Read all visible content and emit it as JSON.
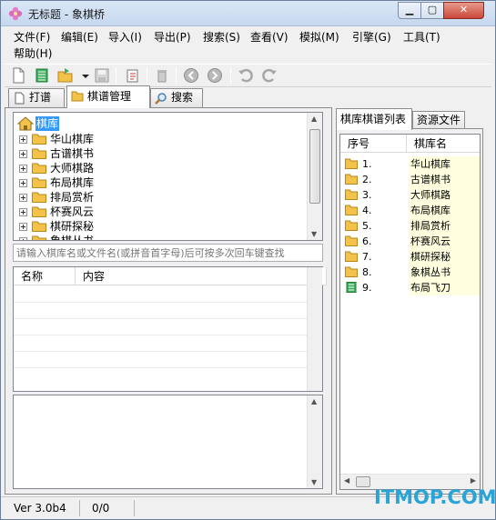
{
  "window": {
    "title": "无标题 - 象棋桥"
  },
  "menu": [
    "文件(F)",
    "编辑(E)",
    "导入(I)",
    "导出(P)",
    "搜索(S)",
    "查看(V)",
    "模拟(M)",
    "引擎(G)",
    "工具(T)",
    "帮助(H)"
  ],
  "left_tabs": [
    "打谱",
    "棋谱管理",
    "搜索"
  ],
  "tree": {
    "root": "棋库",
    "children": [
      "华山棋库",
      "古谱棋书",
      "大师棋路",
      "布局棋库",
      "排局赏析",
      "杯赛风云",
      "棋研探秘",
      "象棋丛书"
    ]
  },
  "search": {
    "placeholder": "请输入棋库名或文件名(或拼音首字母)后可按多次回车键查找"
  },
  "left_list": {
    "col_name": "名称",
    "col_content": "内容"
  },
  "right_tabs": [
    "棋库棋谱列表",
    "资源文件"
  ],
  "right_list": {
    "col_no": "序号",
    "col_name": "棋库名",
    "rows": [
      {
        "no": "1.",
        "name": "华山棋库",
        "icon": "folder-icon"
      },
      {
        "no": "2.",
        "name": "古谱棋书",
        "icon": "folder-icon"
      },
      {
        "no": "3.",
        "name": "大师棋路",
        "icon": "folder-icon"
      },
      {
        "no": "4.",
        "name": "布局棋库",
        "icon": "folder-icon"
      },
      {
        "no": "5.",
        "name": "排局赏析",
        "icon": "folder-icon"
      },
      {
        "no": "6.",
        "name": "杯赛风云",
        "icon": "folder-icon"
      },
      {
        "no": "7.",
        "name": "棋研探秘",
        "icon": "folder-icon"
      },
      {
        "no": "8.",
        "name": "象棋丛书",
        "icon": "folder-icon"
      },
      {
        "no": "9.",
        "name": "布局飞刀",
        "icon": "document-icon"
      }
    ]
  },
  "status": {
    "version": "Ver 3.0b4",
    "count": "0/0"
  },
  "watermark": "ITMOP.COM",
  "colors": {
    "selection": "#3399ff",
    "folder": "#f2c24a",
    "row_highlight": "#ffffe0",
    "watermark": "#2aa3d6"
  }
}
